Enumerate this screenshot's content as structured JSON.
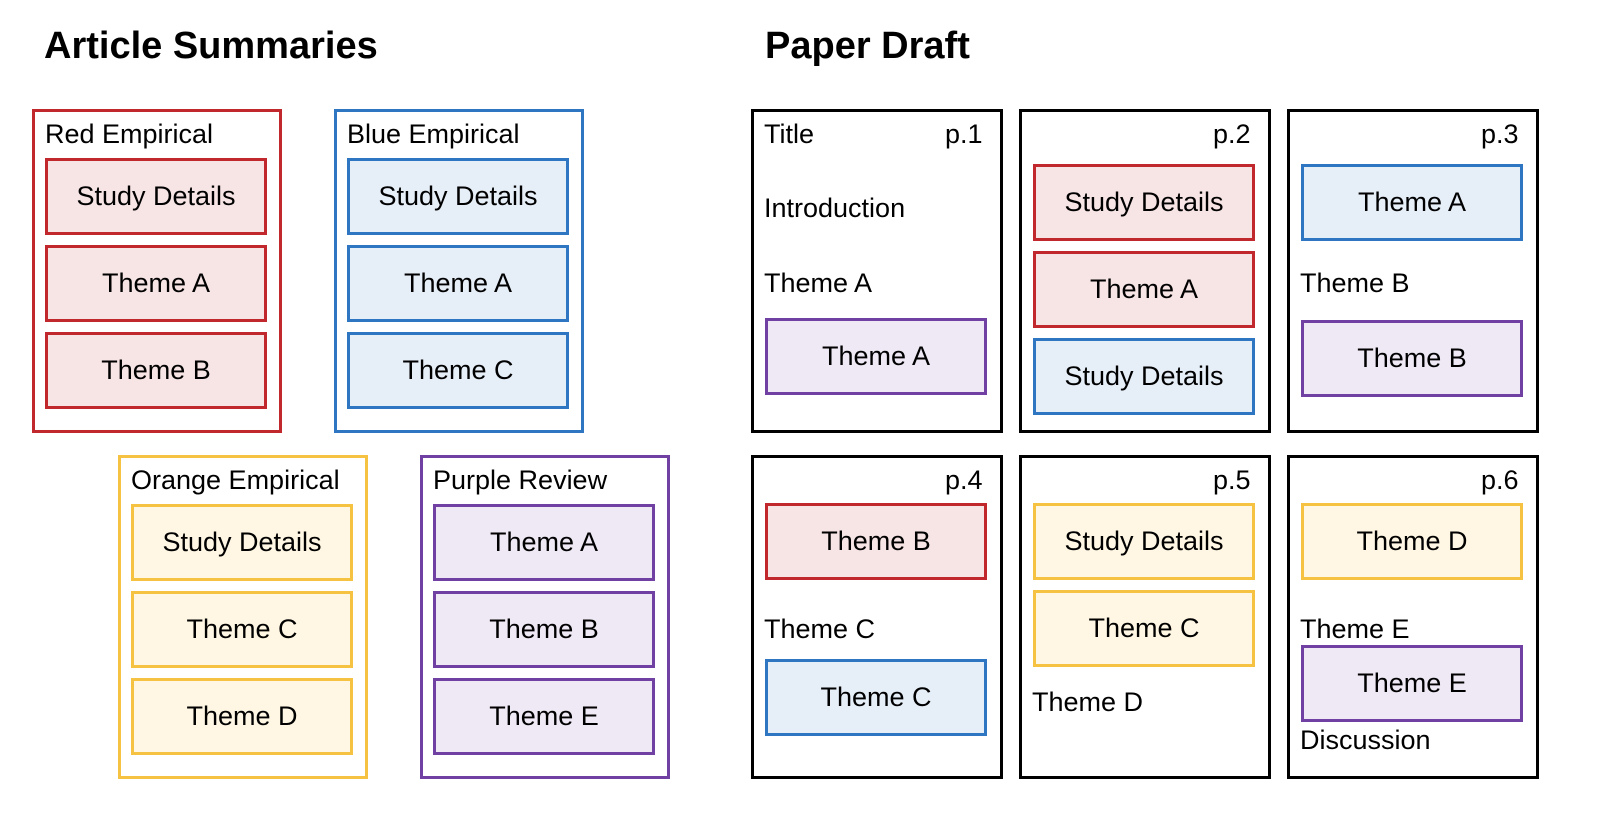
{
  "colors": {
    "red": {
      "border": "#c0282d",
      "fill": "#f7e4e4"
    },
    "blue": {
      "border": "#2e75c2",
      "fill": "#e6eef8"
    },
    "orange": {
      "border": "#f5c242",
      "fill": "#fff7e3"
    },
    "purple": {
      "border": "#7040a3",
      "fill": "#efe8f5"
    },
    "black": {
      "border": "#000000"
    }
  },
  "article_summaries": {
    "title": "Article Summaries",
    "articles": [
      {
        "name": "Red Empirical",
        "color": "red",
        "cards": [
          "Study Details",
          "Theme A",
          "Theme B"
        ]
      },
      {
        "name": "Blue Empirical",
        "color": "blue",
        "cards": [
          "Study Details",
          "Theme A",
          "Theme C"
        ]
      },
      {
        "name": "Orange Empirical",
        "color": "orange",
        "cards": [
          "Study Details",
          "Theme C",
          "Theme D"
        ]
      },
      {
        "name": "Purple Review",
        "color": "purple",
        "cards": [
          "Theme A",
          "Theme B",
          "Theme E"
        ]
      }
    ]
  },
  "paper_draft": {
    "title": "Paper Draft",
    "pages": [
      {
        "page": "p.1",
        "items": [
          {
            "kind": "text",
            "text": "Title"
          },
          {
            "kind": "text",
            "text": "Introduction"
          },
          {
            "kind": "text",
            "text": "Theme A"
          },
          {
            "kind": "card",
            "text": "Theme A",
            "color": "purple"
          }
        ]
      },
      {
        "page": "p.2",
        "items": [
          {
            "kind": "card",
            "text": "Study Details",
            "color": "red"
          },
          {
            "kind": "card",
            "text": "Theme A",
            "color": "red"
          },
          {
            "kind": "card",
            "text": "Study Details",
            "color": "blue"
          }
        ]
      },
      {
        "page": "p.3",
        "items": [
          {
            "kind": "card",
            "text": "Theme A",
            "color": "blue"
          },
          {
            "kind": "text",
            "text": "Theme B"
          },
          {
            "kind": "card",
            "text": "Theme B",
            "color": "purple"
          }
        ]
      },
      {
        "page": "p.4",
        "items": [
          {
            "kind": "card",
            "text": "Theme B",
            "color": "red"
          },
          {
            "kind": "text",
            "text": "Theme C"
          },
          {
            "kind": "card",
            "text": "Theme C",
            "color": "blue"
          }
        ]
      },
      {
        "page": "p.5",
        "items": [
          {
            "kind": "card",
            "text": "Study Details",
            "color": "orange"
          },
          {
            "kind": "card",
            "text": "Theme C",
            "color": "orange"
          },
          {
            "kind": "text",
            "text": "Theme D"
          }
        ]
      },
      {
        "page": "p.6",
        "items": [
          {
            "kind": "card",
            "text": "Theme D",
            "color": "orange"
          },
          {
            "kind": "text",
            "text": "Theme E"
          },
          {
            "kind": "card",
            "text": "Theme E",
            "color": "purple"
          },
          {
            "kind": "text",
            "text": "Discussion"
          }
        ]
      }
    ]
  }
}
